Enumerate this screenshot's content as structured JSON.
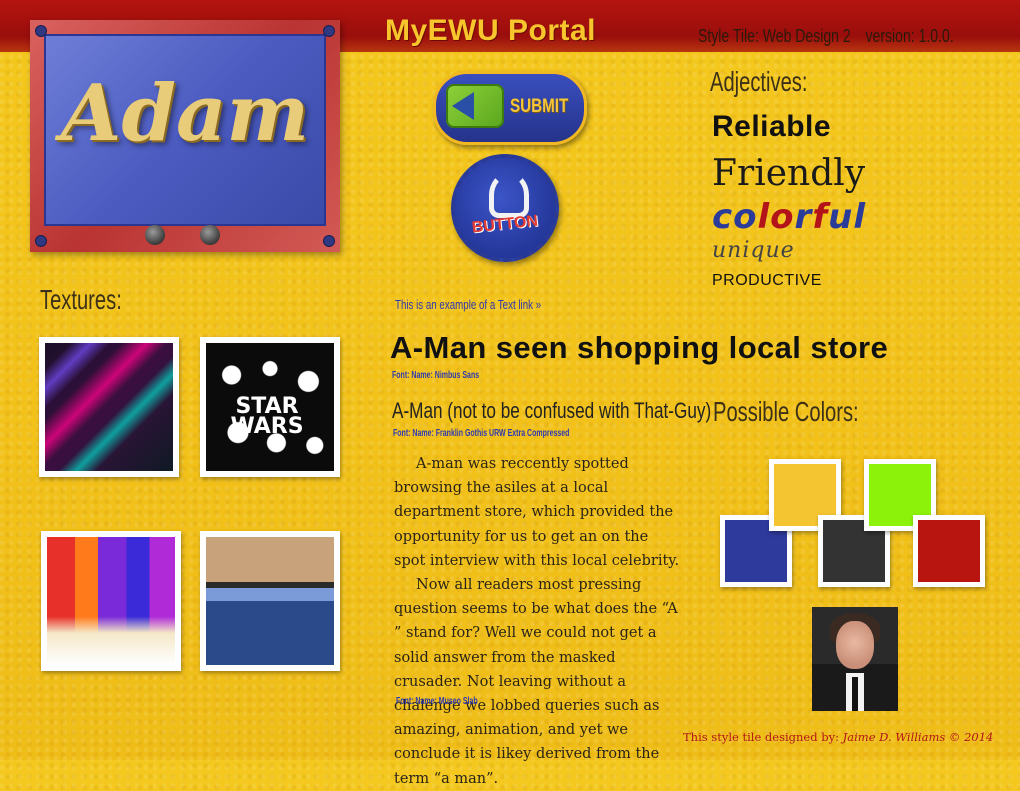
{
  "header": {
    "portal_title": "MyEWU Portal",
    "style_tile": "Style Tile: Web Design 2",
    "version": "version: 1.0.0."
  },
  "logo": {
    "text": "Adam"
  },
  "buttons": {
    "submit_label": "SUBMIT",
    "round_label": "BUTTON"
  },
  "adjectives": {
    "heading": "Adjectives:",
    "items": [
      "Reliable",
      "Friendly",
      "colorful",
      "unique",
      "PRODUCTIVE"
    ],
    "colorful_letters": [
      {
        "ch": "c",
        "color": "#2b3b9a"
      },
      {
        "ch": "o",
        "color": "#2b3b9a"
      },
      {
        "ch": "l",
        "color": "#b2141a"
      },
      {
        "ch": "o",
        "color": "#b2141a"
      },
      {
        "ch": "r",
        "color": "#2b3b9a"
      },
      {
        "ch": "f",
        "color": "#b2141a"
      },
      {
        "ch": "u",
        "color": "#2b3b9a"
      },
      {
        "ch": "l",
        "color": "#2b3b9a"
      }
    ]
  },
  "textures": {
    "heading": "Textures:",
    "star_wars_text": "STAR WARS"
  },
  "link": {
    "text": "This is an example of a Text link »"
  },
  "article": {
    "headline": "A-Man seen shopping local store",
    "headline_font": "Font: Name: Nimbus Sans",
    "subhead": "A-Man (not to be confused with That-Guy)",
    "subhead_font": "Font: Name: Franklin Gothis URW Extra Compressed",
    "paragraphs": [
      "A-man was reccently spotted browsing the asiles at a local department store, which provided the opportunity for us to get an on the spot interview with this local celebrity.",
      "Now all readers most pressing question seems to be what does the “A ” stand for? Well we could not get a solid answer from the masked crusader. Not leaving without a chalenge we lobbed queries such as amazing, animation, and yet we conclude it is likey derived from the term “a man”."
    ],
    "body_font": "Font: Name: Museo Slab"
  },
  "colors": {
    "heading": "Possible Colors:",
    "swatches": [
      {
        "name": "blue",
        "hex": "#2e3a9c"
      },
      {
        "name": "yellow",
        "hex": "#f5c431"
      },
      {
        "name": "charcoal",
        "hex": "#333333"
      },
      {
        "name": "lime",
        "hex": "#8cf20a"
      },
      {
        "name": "red",
        "hex": "#b81410"
      }
    ]
  },
  "credit": {
    "prefix": "This style tile designed by:",
    "author": "Jaime D. Williams",
    "year": "© 2014"
  }
}
